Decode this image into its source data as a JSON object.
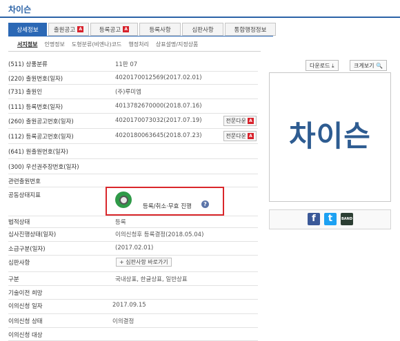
{
  "page_title": "차이슨",
  "tabs": [
    {
      "label": "상세정보",
      "active": true,
      "pdf": false
    },
    {
      "label": "출원공고",
      "active": false,
      "pdf": true
    },
    {
      "label": "등록공고",
      "active": false,
      "pdf": true
    },
    {
      "label": "등록사항",
      "active": false,
      "pdf": false
    },
    {
      "label": "심판사항",
      "active": false,
      "pdf": false
    },
    {
      "label": "통합행정정보",
      "active": false,
      "pdf": false
    }
  ],
  "subtabs": [
    "서지정보",
    "인명정보",
    "도형분류(비엔나)코드",
    "행정처리",
    "상표설명/지정상품"
  ],
  "pdf_icon_text": "A",
  "fields": [
    {
      "label": "(511) 상품분류",
      "value": "11판         07"
    },
    {
      "label": "(220) 출원번호(일자)",
      "value": "4020170012569(2017.02.01)"
    },
    {
      "label": "(731) 출원인",
      "value": "(주)루미엠"
    },
    {
      "label": "(111) 등록번호(일자)",
      "value": "4013782670000(2018.07.16)"
    },
    {
      "label": "(260) 출원공고번호(일자)",
      "value": "4020170073032(2017.07.19)",
      "button": "전문다운"
    },
    {
      "label": "(112) 등록공고번호(일자)",
      "value": "4020180063645(2018.07.23)",
      "button": "전문다운"
    },
    {
      "label": "(641) 원출원번호(일자)",
      "value": ""
    },
    {
      "label": "(300) 우선권주장번호(일자)",
      "value": ""
    },
    {
      "label": "관련출원번호",
      "value": ""
    },
    {
      "label": "공동상태지표",
      "value": ""
    },
    {
      "label": "법적상태",
      "value": "등록"
    },
    {
      "label": "심사진행상태(일자)",
      "value": "이의신청후 등록결정(2018.05.04)"
    },
    {
      "label": "소급구분(일자)",
      "value": "(2017.02.01)"
    },
    {
      "label": "심판사항",
      "value": ""
    },
    {
      "label": "구분",
      "value": "국내상표, 한글상표, 일반상표"
    },
    {
      "label": "기술이전 희망",
      "value": ""
    },
    {
      "label": "이의신청 일자",
      "value": "2017.09.15"
    },
    {
      "label": "이의신청 상태",
      "value": "이의결정"
    },
    {
      "label": "이의신청 대상",
      "value": ""
    }
  ],
  "status_text": "등록/취소·무효 진행",
  "help_icon_text": "?",
  "shortcut_button": "+ 심판사항 바로가기",
  "download_button": "다운로드 ⤓",
  "zoom_button": "크게보기 🔍",
  "mark_image_text": "차이슨",
  "share": {
    "facebook": "f",
    "twitter": "t",
    "band": "BAND"
  },
  "colors": {
    "accent": "#2b68b5",
    "mark": "#2e5c91",
    "status_border": "#d9262a"
  }
}
